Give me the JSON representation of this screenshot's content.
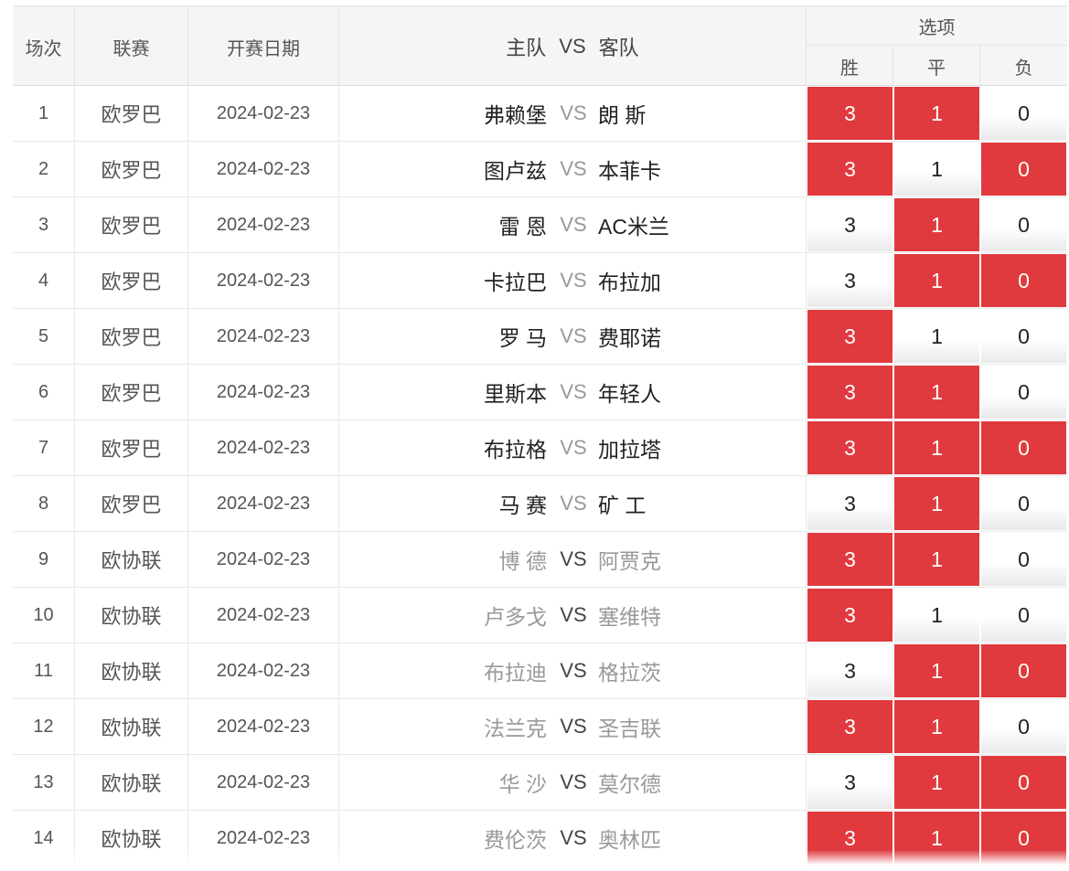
{
  "header": {
    "col_index": "场次",
    "col_league": "联赛",
    "col_date": "开赛日期",
    "col_home": "主队",
    "col_vs": "VS",
    "col_away": "客队",
    "col_options": "选项",
    "opt_win": "胜",
    "opt_draw": "平",
    "opt_lose": "负"
  },
  "colors": {
    "selected": "#e03a3e",
    "header_bg": "#f5f5f5"
  },
  "rows": [
    {
      "idx": "1",
      "league": "欧罗巴",
      "date": "2024-02-23",
      "home": "弗赖堡",
      "vs": "VS",
      "away": "朗 斯",
      "opts": [
        "3",
        "1",
        "0"
      ],
      "sel": [
        true,
        true,
        false
      ],
      "group": "europa"
    },
    {
      "idx": "2",
      "league": "欧罗巴",
      "date": "2024-02-23",
      "home": "图卢兹",
      "vs": "VS",
      "away": "本菲卡",
      "opts": [
        "3",
        "1",
        "0"
      ],
      "sel": [
        true,
        false,
        true
      ],
      "group": "europa"
    },
    {
      "idx": "3",
      "league": "欧罗巴",
      "date": "2024-02-23",
      "home": "雷 恩",
      "vs": "VS",
      "away": "AC米兰",
      "opts": [
        "3",
        "1",
        "0"
      ],
      "sel": [
        false,
        true,
        false
      ],
      "group": "europa"
    },
    {
      "idx": "4",
      "league": "欧罗巴",
      "date": "2024-02-23",
      "home": "卡拉巴",
      "vs": "VS",
      "away": "布拉加",
      "opts": [
        "3",
        "1",
        "0"
      ],
      "sel": [
        false,
        true,
        true
      ],
      "group": "europa"
    },
    {
      "idx": "5",
      "league": "欧罗巴",
      "date": "2024-02-23",
      "home": "罗 马",
      "vs": "VS",
      "away": "费耶诺",
      "opts": [
        "3",
        "1",
        "0"
      ],
      "sel": [
        true,
        false,
        false
      ],
      "group": "europa"
    },
    {
      "idx": "6",
      "league": "欧罗巴",
      "date": "2024-02-23",
      "home": "里斯本",
      "vs": "VS",
      "away": "年轻人",
      "opts": [
        "3",
        "1",
        "0"
      ],
      "sel": [
        true,
        true,
        false
      ],
      "group": "europa"
    },
    {
      "idx": "7",
      "league": "欧罗巴",
      "date": "2024-02-23",
      "home": "布拉格",
      "vs": "VS",
      "away": "加拉塔",
      "opts": [
        "3",
        "1",
        "0"
      ],
      "sel": [
        true,
        true,
        true
      ],
      "group": "europa"
    },
    {
      "idx": "8",
      "league": "欧罗巴",
      "date": "2024-02-23",
      "home": "马 赛",
      "vs": "VS",
      "away": "矿 工",
      "opts": [
        "3",
        "1",
        "0"
      ],
      "sel": [
        false,
        true,
        false
      ],
      "group": "europa"
    },
    {
      "idx": "9",
      "league": "欧协联",
      "date": "2024-02-23",
      "home": "博 德",
      "vs": "VS",
      "away": "阿贾克",
      "opts": [
        "3",
        "1",
        "0"
      ],
      "sel": [
        true,
        true,
        false
      ],
      "group": "conference"
    },
    {
      "idx": "10",
      "league": "欧协联",
      "date": "2024-02-23",
      "home": "卢多戈",
      "vs": "VS",
      "away": "塞维特",
      "opts": [
        "3",
        "1",
        "0"
      ],
      "sel": [
        true,
        false,
        false
      ],
      "group": "conference"
    },
    {
      "idx": "11",
      "league": "欧协联",
      "date": "2024-02-23",
      "home": "布拉迪",
      "vs": "VS",
      "away": "格拉茨",
      "opts": [
        "3",
        "1",
        "0"
      ],
      "sel": [
        false,
        true,
        true
      ],
      "group": "conference"
    },
    {
      "idx": "12",
      "league": "欧协联",
      "date": "2024-02-23",
      "home": "法兰克",
      "vs": "VS",
      "away": "圣吉联",
      "opts": [
        "3",
        "1",
        "0"
      ],
      "sel": [
        true,
        true,
        false
      ],
      "group": "conference"
    },
    {
      "idx": "13",
      "league": "欧协联",
      "date": "2024-02-23",
      "home": "华 沙",
      "vs": "VS",
      "away": "莫尔德",
      "opts": [
        "3",
        "1",
        "0"
      ],
      "sel": [
        false,
        true,
        true
      ],
      "group": "conference"
    },
    {
      "idx": "14",
      "league": "欧协联",
      "date": "2024-02-23",
      "home": "费伦茨",
      "vs": "VS",
      "away": "奥林匹",
      "opts": [
        "3",
        "1",
        "0"
      ],
      "sel": [
        true,
        true,
        true
      ],
      "group": "conference"
    }
  ]
}
